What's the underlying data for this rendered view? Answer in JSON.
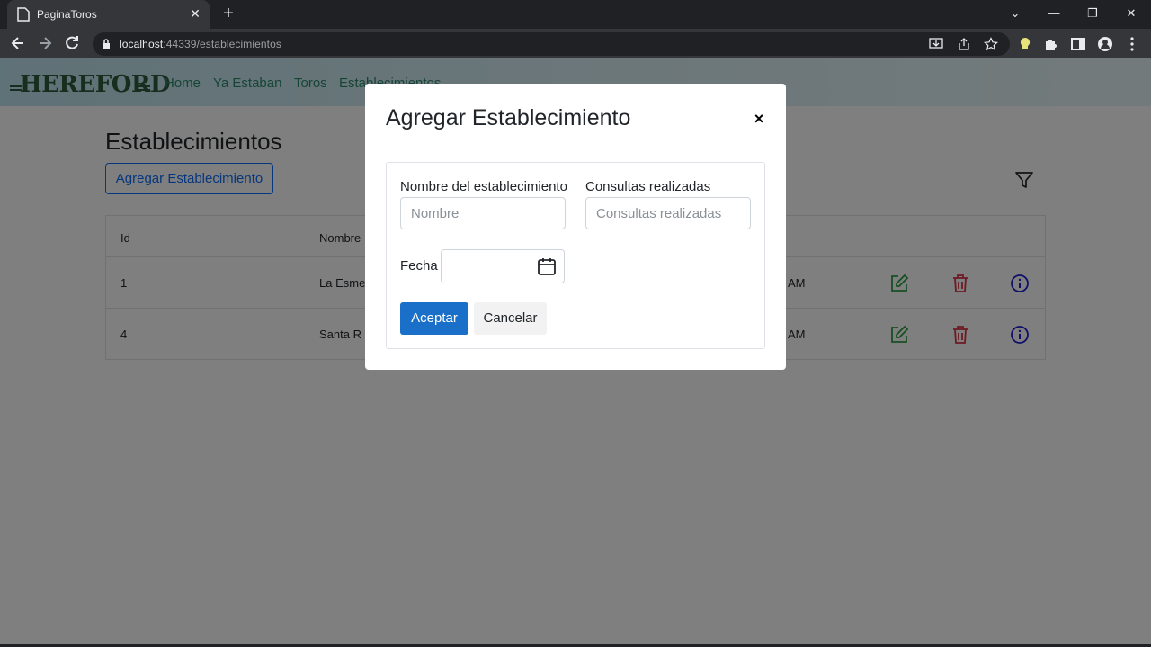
{
  "browser": {
    "tab_title": "PaginaToros",
    "url_host": "localhost",
    "url_path": ":44339/establecimientos"
  },
  "navbar": {
    "logo": "HEREFORD",
    "links": [
      "Home",
      "Ya Estaban",
      "Toros",
      "Establecimientos"
    ]
  },
  "page": {
    "title": "Establecimientos",
    "add_button": "Agregar Establecimiento",
    "table": {
      "headers": [
        "Id",
        "Nombre"
      ],
      "rows": [
        {
          "id": "1",
          "nombre": "La Esme",
          "time": "AM"
        },
        {
          "id": "4",
          "nombre": "Santa R",
          "time": "AM"
        }
      ]
    }
  },
  "modal": {
    "title": "Agregar Establecimiento",
    "close": "×",
    "fields": {
      "nombre_label": "Nombre del establecimiento",
      "nombre_placeholder": "Nombre",
      "consultas_label": "Consultas realizadas",
      "consultas_placeholder": "Consultas realizadas",
      "fecha_label": "Fecha"
    },
    "accept": "Aceptar",
    "cancel": "Cancelar"
  },
  "colors": {
    "primary": "#1a6fc9",
    "outline": "#0d6efd",
    "edit": "#2e9e44",
    "delete": "#dc3545",
    "info": "#1f1fd6",
    "nav_link": "#2c8a6c"
  }
}
